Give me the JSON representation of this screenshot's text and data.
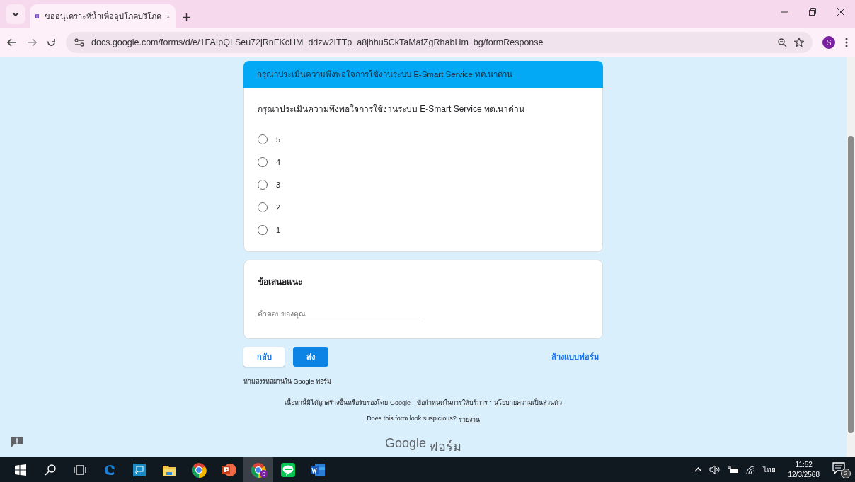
{
  "browser": {
    "tab": {
      "title": "ขออนุเคราะห์น้ำเพื่ออุปโภคบริโภค",
      "selected": true
    },
    "url": "docs.google.com/forms/d/e/1FAIpQLSeu72jRnFKcHM_ddzw2ITTp_a8jhhu5CkTaMafZgRhabHm_bg/formResponse",
    "profile_letter": "S"
  },
  "form": {
    "section_title": "กรุณาประเมินความพึงพอใจการใช้งานระบบ E-Smart Service ทต.นาด่าน",
    "question": {
      "title": "กรุณาประเมินความพึงพอใจการใช้งานระบบ E-Smart Service ทต.นาด่าน",
      "options": [
        {
          "label": "5",
          "selected": false
        },
        {
          "label": "4",
          "selected": false
        },
        {
          "label": "3",
          "selected": false
        },
        {
          "label": "2",
          "selected": false
        },
        {
          "label": "1",
          "selected": false
        }
      ]
    },
    "suggestion": {
      "title": "ข้อเสนอแนะ",
      "placeholder": "คำตอบของคุณ"
    },
    "buttons": {
      "back": "กลับ",
      "submit": "ส่ง",
      "clear": "ล้างแบบฟอร์ม"
    },
    "password_warning": "ห้ามส่งรหัสผ่านใน Google ฟอร์ม",
    "disclaimer": "เนื้อหานี้มิได้ถูกสร้างขึ้นหรือรับรองโดย Google -",
    "terms_link": "ข้อกำหนดในการให้บริการ",
    "separator": "-",
    "privacy_link": "นโยบายความเป็นส่วนตัว",
    "suspicious": "Does this form look suspicious?",
    "report_link": "รายงาน",
    "logo": {
      "brand": "Google",
      "product": "ฟอร์ม"
    }
  },
  "taskbar": {
    "apps": [
      {
        "kind": "edge",
        "active": false
      },
      {
        "kind": "connect",
        "active": false
      },
      {
        "kind": "folder",
        "active": false
      },
      {
        "kind": "chrome",
        "active": false
      },
      {
        "kind": "powerpoint",
        "active": false
      },
      {
        "kind": "chrome-profile",
        "active": true
      },
      {
        "kind": "line",
        "active": false
      },
      {
        "kind": "word",
        "active": false
      }
    ],
    "profile_letter": "S",
    "language": "ไทย",
    "time": "11:52",
    "date": "12/3/2568",
    "notification_count": "2"
  }
}
